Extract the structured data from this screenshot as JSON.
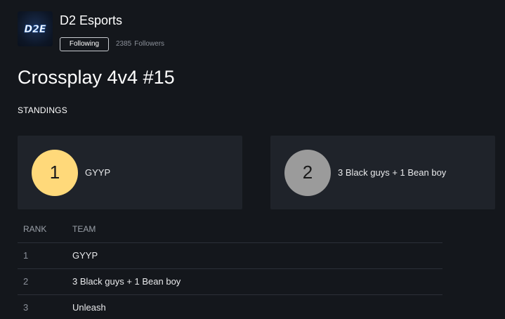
{
  "organizer": {
    "logo_text": "D2E",
    "name": "D2 Esports",
    "follow_label": "Following",
    "followers_count": "2385",
    "followers_label": "Followers"
  },
  "tournament": {
    "title": "Crossplay 4v4 #15"
  },
  "standings": {
    "section_label": "STANDINGS",
    "podium": [
      {
        "rank": "1",
        "team": "GYYP",
        "color": "#ffd97a"
      },
      {
        "rank": "2",
        "team": "3 Black guys + 1 Bean boy",
        "color": "#9b9b9b"
      }
    ],
    "table": {
      "headers": {
        "rank": "RANK",
        "team": "TEAM"
      },
      "rows": [
        {
          "rank": "1",
          "team": "GYYP"
        },
        {
          "rank": "2",
          "team": "3 Black guys + 1 Bean boy"
        },
        {
          "rank": "3",
          "team": "Unleash"
        }
      ]
    }
  },
  "colors": {
    "background": "#14171c",
    "card": "#1f232a",
    "first_place": "#ffd97a",
    "second_place": "#9b9b9b"
  }
}
